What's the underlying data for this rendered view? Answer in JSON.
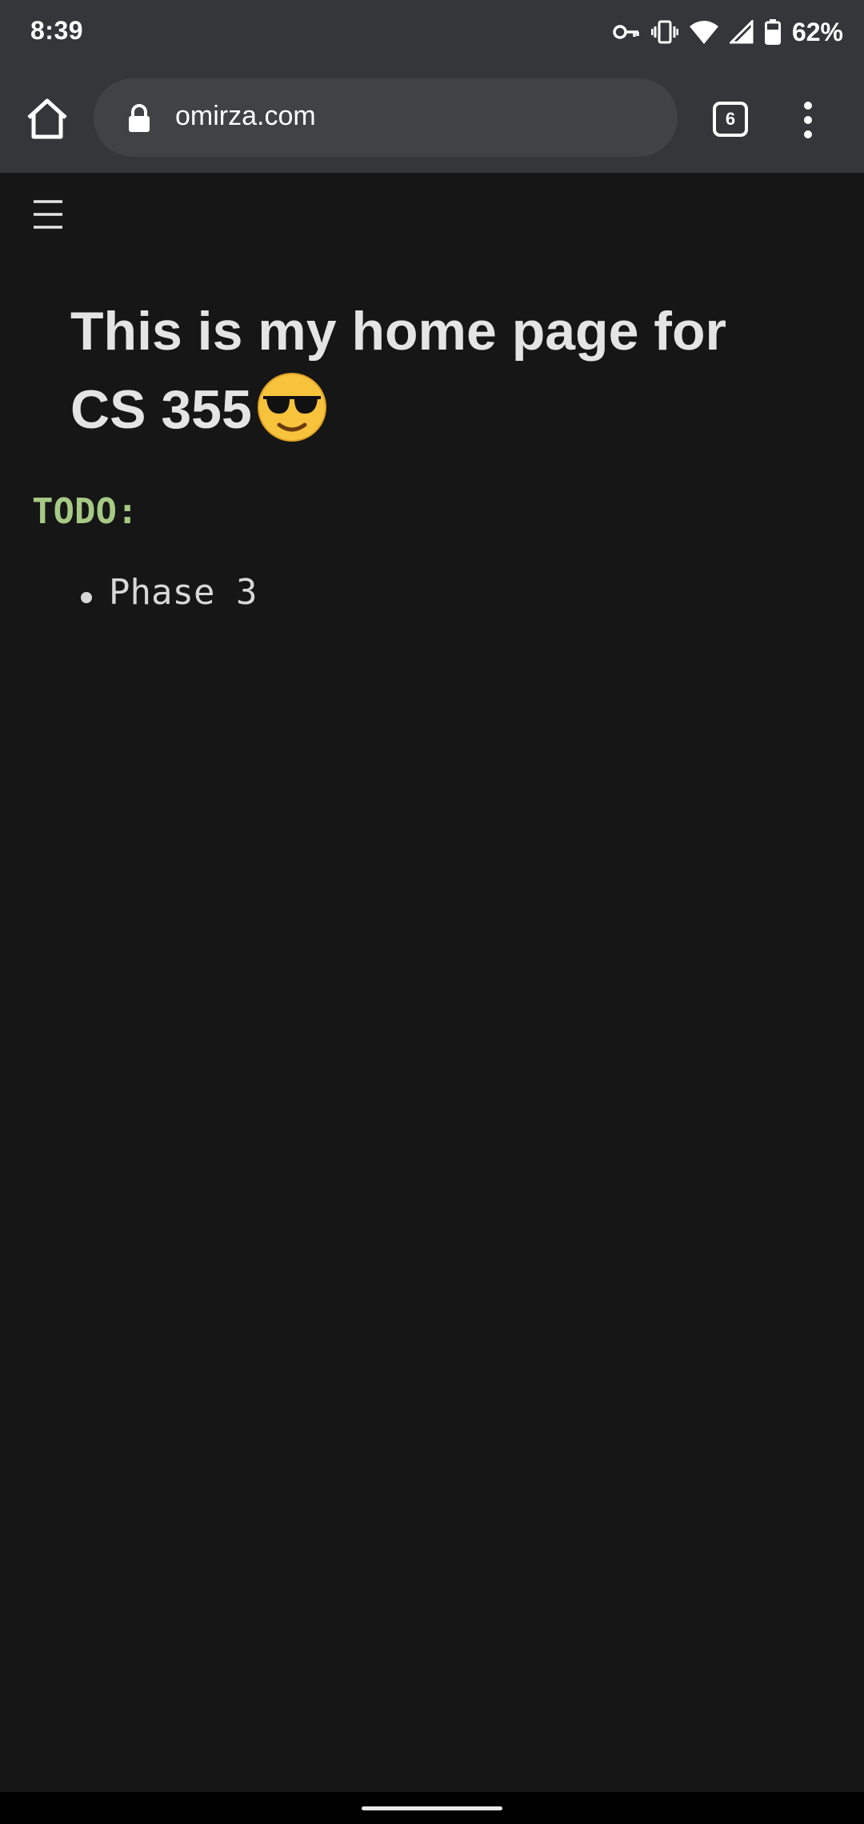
{
  "status_bar": {
    "time": "8:39",
    "battery": "62%",
    "icons": [
      "vpn-key-icon",
      "vibrate-icon",
      "wifi-icon",
      "cell-signal-icon",
      "battery-icon"
    ]
  },
  "browser": {
    "url": "omirza.com",
    "tab_count": "6"
  },
  "page": {
    "heading": "This is my home page for CS 355",
    "todo_label": "TODO:",
    "todo_items": [
      "Phase 3"
    ]
  },
  "colors": {
    "page_background": "#161616",
    "chrome_background": "#35363a",
    "todo_accent": "#a6c985"
  }
}
